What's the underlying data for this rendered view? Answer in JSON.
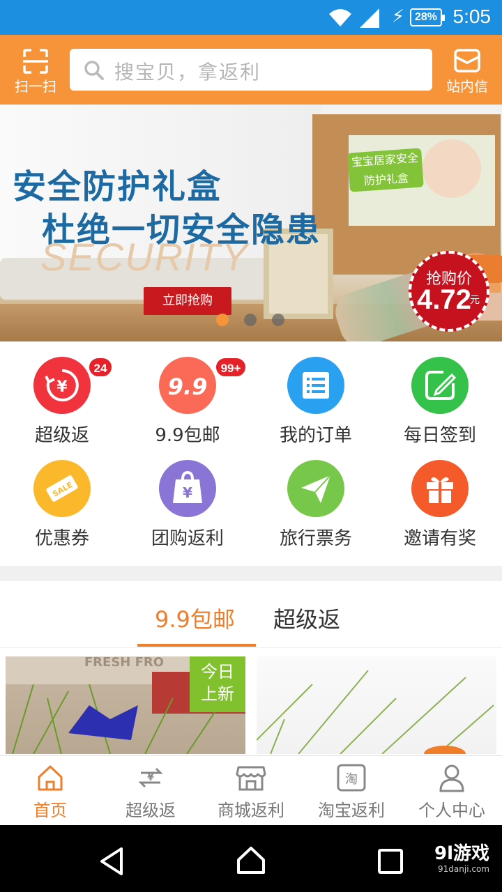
{
  "status_bar": {
    "time": "5:05",
    "battery": "28%"
  },
  "header": {
    "scan_label": "扫一扫",
    "search_placeholder": "搜宝贝，拿返利",
    "message_label": "站内信"
  },
  "banner": {
    "line1": "安全防护礼盒",
    "line2": "杜绝一切安全隐患",
    "line3": "SECURITY",
    "cta": "立即抢购",
    "box_label": "宝宝居家安全防护礼盒",
    "price_label": "抢购价",
    "price_value": "4.72",
    "price_unit": "元",
    "active_dot": 0,
    "dot_count": 3
  },
  "grid": [
    {
      "label": "超级返",
      "icon": "yen-refresh-icon",
      "color": "#f0333c",
      "badge": "24"
    },
    {
      "label": "9.9包邮",
      "icon": "nine-nine-icon",
      "color": "#fb6a57",
      "badge": "99+"
    },
    {
      "label": "我的订单",
      "icon": "order-list-icon",
      "color": "#2aa0f0",
      "badge": ""
    },
    {
      "label": "每日签到",
      "icon": "sign-pen-icon",
      "color": "#35c24a",
      "badge": ""
    },
    {
      "label": "优惠券",
      "icon": "coupon-sale-icon",
      "color": "#fbb82b",
      "badge": ""
    },
    {
      "label": "团购返利",
      "icon": "yen-bag-icon",
      "color": "#8a74d6",
      "badge": ""
    },
    {
      "label": "旅行票务",
      "icon": "paper-plane-icon",
      "color": "#77c74a",
      "badge": ""
    },
    {
      "label": "邀请有奖",
      "icon": "gift-icon",
      "color": "#f55a2a",
      "badge": ""
    }
  ],
  "tabs": [
    {
      "label": "9.9包邮",
      "active": true
    },
    {
      "label": "超级返",
      "active": false
    }
  ],
  "products": {
    "new_tag": "今日上新",
    "new_tag_line1": "今日",
    "new_tag_line2": "上新"
  },
  "bottom_nav": [
    {
      "label": "首页",
      "icon": "home-icon",
      "active": true
    },
    {
      "label": "超级返",
      "icon": "yen-exchange-icon",
      "active": false
    },
    {
      "label": "商城返利",
      "icon": "store-icon",
      "active": false
    },
    {
      "label": "淘宝返利",
      "icon": "taobao-icon",
      "active": false
    },
    {
      "label": "个人中心",
      "icon": "person-icon",
      "active": false
    }
  ],
  "watermark": {
    "brand": "9l游戏",
    "site": "91danji.com"
  },
  "colors": {
    "header": "#f7943a",
    "status_bar": "#1c8fe0",
    "accent": "#f07d2a"
  }
}
